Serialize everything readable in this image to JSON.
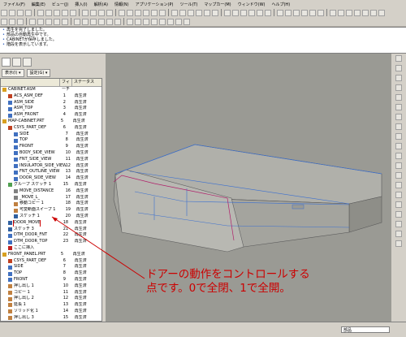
{
  "menu": [
    "ファイル(F)",
    "編集(E)",
    "ビュー(J)",
    "挿入(I)",
    "解析(A)",
    "情報(N)",
    "アプリケーション(P)",
    "ツール(T)",
    "マップカー(M)",
    "ウィンドウ(W)",
    "ヘルプ(H)"
  ],
  "messages": [
    "再生を完了しました。",
    "部品の自動再生中です。",
    "CABINETが保存しました。",
    "階段を表示しています。"
  ],
  "dropdowns": {
    "display": "表示(I)",
    "settings": "設定(G)"
  },
  "tree": {
    "headers": {
      "name": "",
      "feature": "フィーチ",
      "status": "ステータス"
    },
    "rows": [
      {
        "name": "CABINET.ASM",
        "id": "",
        "status": "",
        "icon": "asm",
        "indent": 0
      },
      {
        "name": "ACS_ASM_DEF",
        "id": "1",
        "status": "再生済",
        "icon": "csys",
        "indent": 1
      },
      {
        "name": "ASM_SIDE",
        "id": "2",
        "status": "再生済",
        "icon": "plane",
        "indent": 1
      },
      {
        "name": "ASM_TOP",
        "id": "3",
        "status": "再生済",
        "icon": "plane",
        "indent": 1
      },
      {
        "name": "ASM_FRONT",
        "id": "4",
        "status": "再生済",
        "icon": "plane",
        "indent": 1
      },
      {
        "name": "MAP-CABINET.PRT",
        "id": "5",
        "status": "再生済",
        "icon": "part",
        "indent": 0
      },
      {
        "name": "CSYS_PART_DEF",
        "id": "6",
        "status": "再生済",
        "icon": "csys",
        "indent": 1
      },
      {
        "name": "SIDE",
        "id": "7",
        "status": "再生済",
        "icon": "plane",
        "indent": 2
      },
      {
        "name": "TOP",
        "id": "8",
        "status": "再生済",
        "icon": "plane",
        "indent": 2
      },
      {
        "name": "FRONT",
        "id": "9",
        "status": "再生済",
        "icon": "plane",
        "indent": 2
      },
      {
        "name": "BODY_SIDE_VIEW",
        "id": "10",
        "status": "再生済",
        "icon": "plane",
        "indent": 2
      },
      {
        "name": "FNT_SIDE_VIEW",
        "id": "11",
        "status": "再生済",
        "icon": "plane",
        "indent": 2
      },
      {
        "name": "INSULATOR_SIDE_VIEW",
        "id": "12",
        "status": "再生済",
        "icon": "plane",
        "indent": 2
      },
      {
        "name": "FNT_OUTLINE_VIEW",
        "id": "13",
        "status": "再生済",
        "icon": "plane",
        "indent": 2
      },
      {
        "name": "DOOR_SIDE_VIEW",
        "id": "14",
        "status": "再生済",
        "icon": "plane",
        "indent": 2
      },
      {
        "name": "グループ スケッチ 1",
        "id": "15",
        "status": "再生済",
        "icon": "group",
        "indent": 1
      },
      {
        "name": "MOVE_DISTANCE",
        "id": "16",
        "status": "再生済",
        "icon": "param",
        "indent": 2
      },
      {
        "name": "_MOVE_L_",
        "id": "17",
        "status": "再生済",
        "icon": "param",
        "indent": 2
      },
      {
        "name": "移動コピー 1",
        "id": "18",
        "status": "再生済",
        "icon": "feat",
        "indent": 2
      },
      {
        "name": "可変断面スイープ 1",
        "id": "19",
        "status": "再生済",
        "icon": "feat",
        "indent": 2
      },
      {
        "name": "スケッチ 1",
        "id": "20",
        "status": "再生済",
        "icon": "sketch",
        "indent": 2
      },
      {
        "name": "DOOR_MOVE",
        "id": "18",
        "status": "再生済",
        "icon": "sketch",
        "indent": 1,
        "highlight": true
      },
      {
        "name": "スケッチ 3",
        "id": "21",
        "status": "再生済",
        "icon": "sketch",
        "indent": 1
      },
      {
        "name": "DTM_DOOR_FNT",
        "id": "22",
        "status": "再生済",
        "icon": "plane",
        "indent": 1
      },
      {
        "name": "DTM_DOOR_TOP",
        "id": "23",
        "status": "再生済",
        "icon": "plane",
        "indent": 1
      },
      {
        "name": "ここに挿入",
        "id": "",
        "status": "",
        "icon": "insert",
        "indent": 1
      },
      {
        "name": "FRONT_PANEL.PRT",
        "id": "5",
        "status": "再生済",
        "icon": "part",
        "indent": 0
      },
      {
        "name": "CSYS_PART_DEF",
        "id": "6",
        "status": "再生済",
        "icon": "csys",
        "indent": 1
      },
      {
        "name": "SIDE",
        "id": "7",
        "status": "再生済",
        "icon": "plane",
        "indent": 1
      },
      {
        "name": "TOP",
        "id": "8",
        "status": "再生済",
        "icon": "plane",
        "indent": 1
      },
      {
        "name": "FRONT",
        "id": "9",
        "status": "再生済",
        "icon": "plane",
        "indent": 1
      },
      {
        "name": "押し出し 1",
        "id": "10",
        "status": "再生済",
        "icon": "feat",
        "indent": 1
      },
      {
        "name": "コピー 1",
        "id": "11",
        "status": "再生済",
        "icon": "feat",
        "indent": 1
      },
      {
        "name": "押し出し 2",
        "id": "12",
        "status": "再生済",
        "icon": "feat",
        "indent": 1
      },
      {
        "name": "延長 1",
        "id": "13",
        "status": "再生済",
        "icon": "feat",
        "indent": 1
      },
      {
        "name": "ソリッド化 1",
        "id": "14",
        "status": "再生済",
        "icon": "feat",
        "indent": 1
      },
      {
        "name": "押し出し 3",
        "id": "15",
        "status": "再生済",
        "icon": "feat",
        "indent": 1
      },
      {
        "name": "ドラフト 1",
        "id": "16",
        "status": "再生済",
        "icon": "feat",
        "indent": 1
      },
      {
        "name": "ラウンド 1",
        "id": "17",
        "status": "再生済",
        "icon": "feat",
        "indent": 1
      }
    ]
  },
  "annotation": {
    "line1": "ドアーの動作をコントロールする",
    "line2": "点です。0で全閉、1で全開。"
  },
  "status": {
    "field": "部品"
  },
  "colors": {
    "annotation": "#cc0000",
    "viewport": "#9a9a94",
    "edge_blue": "#3a6fd0",
    "edge_magenta": "#b0206a"
  }
}
